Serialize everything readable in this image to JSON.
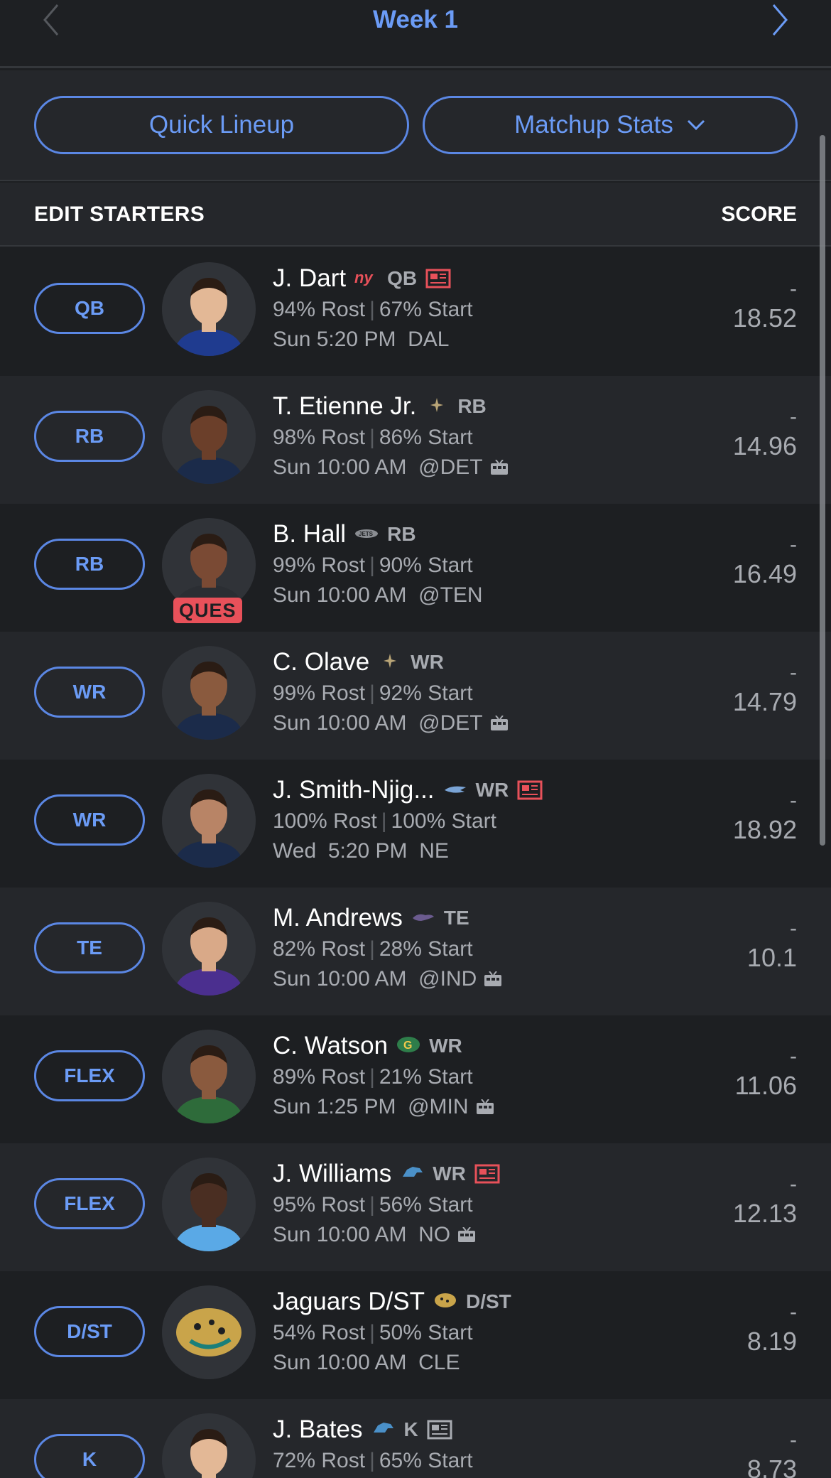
{
  "nav": {
    "title": "Week 1"
  },
  "actions": {
    "quick_lineup": "Quick Lineup",
    "matchup_stats": "Matchup Stats"
  },
  "header": {
    "left": "EDIT STARTERS",
    "right": "SCORE"
  },
  "colors": {
    "accent": "#6b9bf5",
    "background": "#1d1f22",
    "alt_row": "#25272b",
    "ques": "#e8515a"
  },
  "players": [
    {
      "slot": "QB",
      "name": "J. Dart",
      "team_icon": "giants-logo",
      "pos": "QB",
      "news": true,
      "rost": "94% Rost",
      "start": "67% Start",
      "game": "Sun 5:20 PM  DAL",
      "tv": false,
      "actual": "-",
      "proj": "18.52",
      "status": ""
    },
    {
      "slot": "RB",
      "name": "T. Etienne Jr.",
      "team_icon": "saints-logo",
      "pos": "RB",
      "news": false,
      "rost": "98% Rost",
      "start": "86% Start",
      "game": "Sun 10:00 AM  @DET",
      "tv": true,
      "actual": "-",
      "proj": "14.96",
      "status": ""
    },
    {
      "slot": "RB",
      "name": "B. Hall",
      "team_icon": "jets-logo",
      "pos": "RB",
      "news": false,
      "rost": "99% Rost",
      "start": "90% Start",
      "game": "Sun 10:00 AM  @TEN",
      "tv": false,
      "actual": "-",
      "proj": "16.49",
      "status": "QUES"
    },
    {
      "slot": "WR",
      "name": "C. Olave",
      "team_icon": "saints-logo",
      "pos": "WR",
      "news": false,
      "rost": "99% Rost",
      "start": "92% Start",
      "game": "Sun 10:00 AM  @DET",
      "tv": true,
      "actual": "-",
      "proj": "14.79",
      "status": ""
    },
    {
      "slot": "WR",
      "name": "J. Smith-Njig...",
      "team_icon": "seahawks-logo",
      "pos": "WR",
      "news": true,
      "rost": "100% Rost",
      "start": "100% Start",
      "game": "Wed  5:20 PM  NE",
      "tv": false,
      "actual": "-",
      "proj": "18.92",
      "status": ""
    },
    {
      "slot": "TE",
      "name": "M. Andrews",
      "team_icon": "ravens-logo",
      "pos": "TE",
      "news": false,
      "rost": "82% Rost",
      "start": "28% Start",
      "game": "Sun 10:00 AM  @IND",
      "tv": true,
      "actual": "-",
      "proj": "10.1",
      "status": ""
    },
    {
      "slot": "FLEX",
      "name": "C. Watson",
      "team_icon": "packers-logo",
      "pos": "WR",
      "news": false,
      "rost": "89% Rost",
      "start": "21% Start",
      "game": "Sun 1:25 PM  @MIN",
      "tv": true,
      "actual": "-",
      "proj": "11.06",
      "status": ""
    },
    {
      "slot": "FLEX",
      "name": "J. Williams",
      "team_icon": "lions-logo",
      "pos": "WR",
      "news": true,
      "rost": "95% Rost",
      "start": "56% Start",
      "game": "Sun 10:00 AM  NO",
      "tv": true,
      "actual": "-",
      "proj": "12.13",
      "status": ""
    },
    {
      "slot": "D/ST",
      "name": "Jaguars D/ST",
      "team_icon": "jaguars-logo",
      "pos": "D/ST",
      "news": false,
      "rost": "54% Rost",
      "start": "50% Start",
      "game": "Sun 10:00 AM  CLE",
      "tv": false,
      "actual": "-",
      "proj": "8.19",
      "status": ""
    },
    {
      "slot": "K",
      "name": "J. Bates",
      "team_icon": "lions-logo",
      "pos": "K",
      "news": true,
      "rost": "72% Rost",
      "start": "65% Start",
      "game": "",
      "tv": false,
      "actual": "-",
      "proj": "8.73",
      "status": ""
    }
  ]
}
